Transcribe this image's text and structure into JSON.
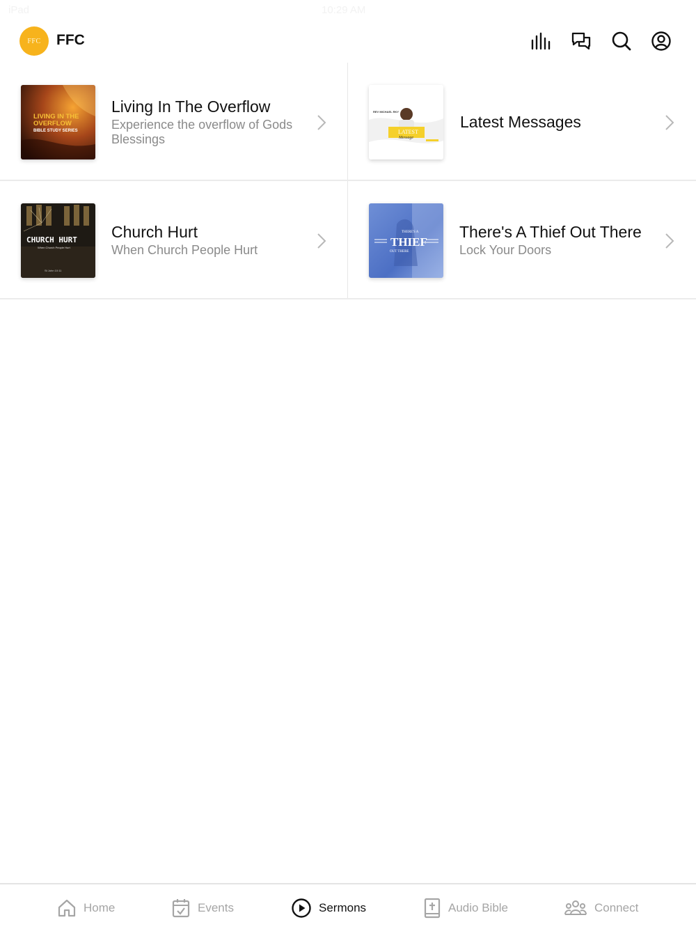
{
  "status": {
    "left": "iPad",
    "time": "10:29 AM"
  },
  "header": {
    "logo_text": "FFC",
    "title": "FFC",
    "icons": [
      "stats-icon",
      "chat-icon",
      "search-icon",
      "profile-icon"
    ]
  },
  "cards": [
    {
      "title": "Living In The Overflow",
      "subtitle": "Experience the overflow of Gods Blessings",
      "thumb": {
        "line1": "LIVING IN THE",
        "line2": "OVERFLOW",
        "line3": "BIBLE STUDY SERIES"
      }
    },
    {
      "title": "Latest Messages",
      "subtitle": "",
      "thumb": {
        "top": "REV MICHAEL RKY",
        "main": "LATEST",
        "script": "Message"
      }
    },
    {
      "title": "Church Hurt",
      "subtitle": "When Church People Hurt",
      "thumb": {
        "main": "CHURCH HURT",
        "sub": "When Church People Hurt",
        "ref": "St John 10:11"
      }
    },
    {
      "title": "There's A Thief Out There",
      "subtitle": "Lock Your Doors",
      "thumb": {
        "top": "THERE'S A",
        "main": "THIEF",
        "sub": "OUT THERE"
      }
    }
  ],
  "tabs": [
    {
      "label": "Home",
      "icon": "home-icon",
      "active": false
    },
    {
      "label": "Events",
      "icon": "calendar-icon",
      "active": false
    },
    {
      "label": "Sermons",
      "icon": "play-circle-icon",
      "active": true
    },
    {
      "label": "Audio Bible",
      "icon": "bible-icon",
      "active": false
    },
    {
      "label": "Connect",
      "icon": "people-icon",
      "active": false
    }
  ],
  "colors": {
    "accent": "#f7b31c",
    "text": "#111111",
    "muted": "#8a8a8a",
    "tab_inactive": "#a5a5a5"
  }
}
